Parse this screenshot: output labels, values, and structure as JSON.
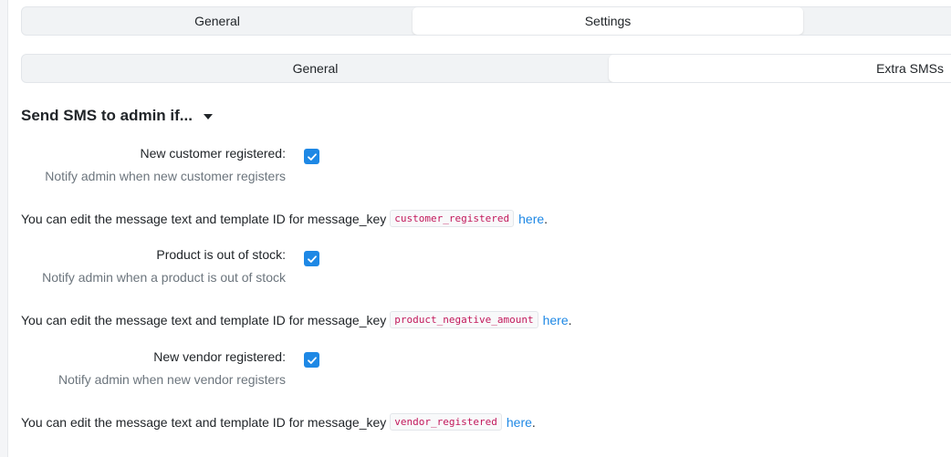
{
  "top_tabs": [
    {
      "label": "General",
      "active": false
    },
    {
      "label": "Settings",
      "active": true
    },
    {
      "label": "",
      "active": false
    }
  ],
  "sub_tabs": [
    {
      "label": "General",
      "active": false
    },
    {
      "label": "Extra SMSs",
      "active": true
    }
  ],
  "section": {
    "title": "Send SMS to admin if..."
  },
  "fields": [
    {
      "label": "New customer registered:",
      "help": "Notify admin when new customer registers",
      "checked": true,
      "info_prefix": "You can edit the message text and template ID for message_key",
      "message_key": "customer_registered",
      "link_text": "here",
      "suffix": "."
    },
    {
      "label": "Product is out of stock:",
      "help": "Notify admin when a product is out of stock",
      "checked": true,
      "info_prefix": "You can edit the message text and template ID for message_key",
      "message_key": "product_negative_amount",
      "link_text": "here",
      "suffix": "."
    },
    {
      "label": "New vendor registered:",
      "help": "Notify admin when new vendor registers",
      "checked": true,
      "info_prefix": "You can edit the message text and template ID for message_key",
      "message_key": "vendor_registered",
      "link_text": "here",
      "suffix": "."
    }
  ],
  "colors": {
    "accent": "#1e88e5",
    "code_text": "#c2185b",
    "muted_text": "#6c757d"
  }
}
